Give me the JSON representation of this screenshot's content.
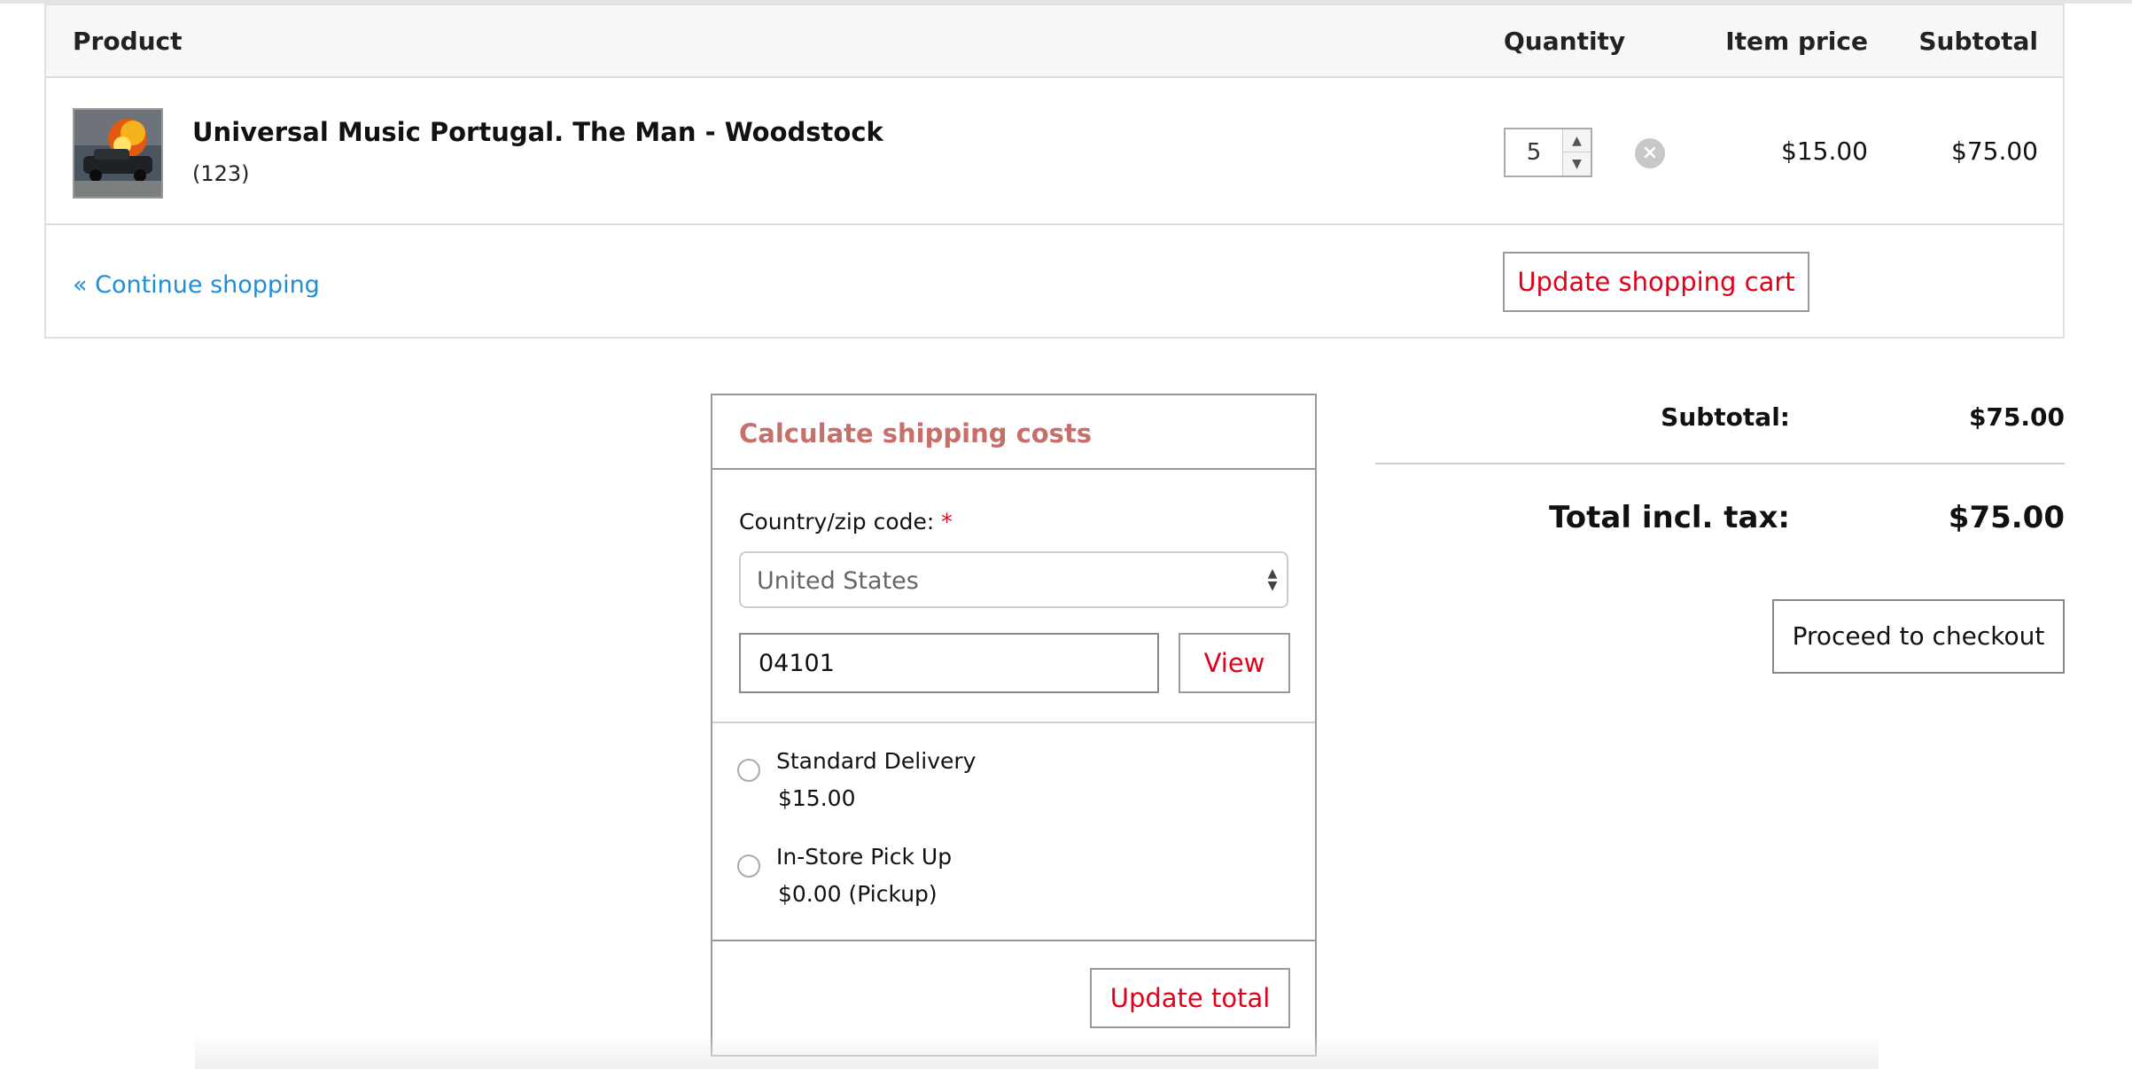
{
  "cart": {
    "headers": {
      "product": "Product",
      "quantity": "Quantity",
      "item_price": "Item price",
      "subtotal": "Subtotal"
    },
    "items": [
      {
        "name": "Universal Music Portugal. The Man - Woodstock",
        "code": "(123)",
        "quantity": "5",
        "item_price": "$15.00",
        "subtotal": "$75.00",
        "image_icon": "album-cover-burning-car"
      }
    ],
    "continue_label": "« Continue shopping",
    "update_cart_label": "Update shopping cart"
  },
  "shipping": {
    "title": "Calculate shipping costs",
    "country_label": "Country/zip code:",
    "required_mark": "*",
    "country_value": "United States",
    "zip_value": "04101",
    "view_label": "View",
    "options": [
      {
        "name": "Standard Delivery",
        "price": "$15.00"
      },
      {
        "name": "In-Store Pick Up",
        "price": "$0.00 (Pickup)"
      }
    ],
    "update_total_label": "Update total"
  },
  "totals": {
    "subtotal_label": "Subtotal:",
    "subtotal_value": "$75.00",
    "total_label": "Total incl. tax:",
    "total_value": "$75.00",
    "checkout_label": "Proceed to checkout"
  },
  "colors": {
    "accent_red": "#e0001a",
    "link_blue": "#1e8fd6",
    "shipping_title": "#c5706a"
  }
}
